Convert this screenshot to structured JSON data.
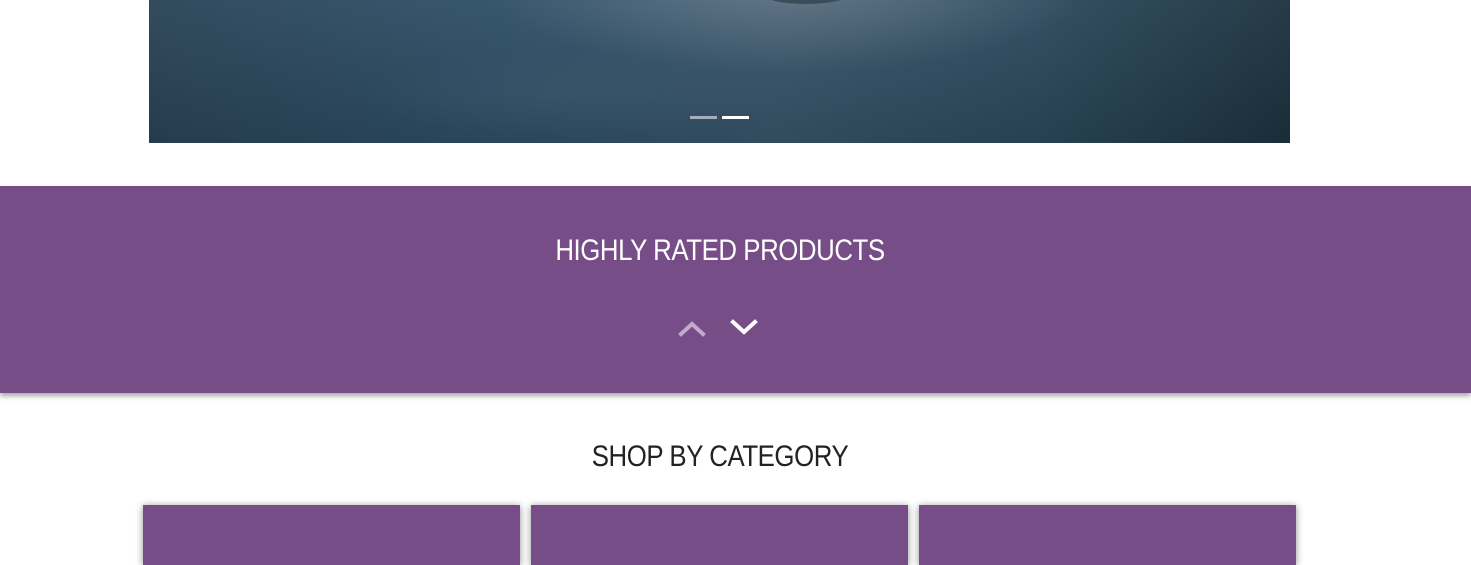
{
  "hero": {
    "slides": [
      {
        "label": "slide-1"
      },
      {
        "label": "slide-2"
      }
    ],
    "active_slide": 2
  },
  "rated": {
    "title": "HIGHLY RATED PRODUCTS",
    "prev_icon": "chevron-up-icon",
    "next_icon": "chevron-down-icon"
  },
  "category": {
    "title": "SHOP BY CATEGORY",
    "card_count": 3
  },
  "colors": {
    "accent": "#774d87",
    "heading_dark": "#222222",
    "background": "#ffffff"
  }
}
